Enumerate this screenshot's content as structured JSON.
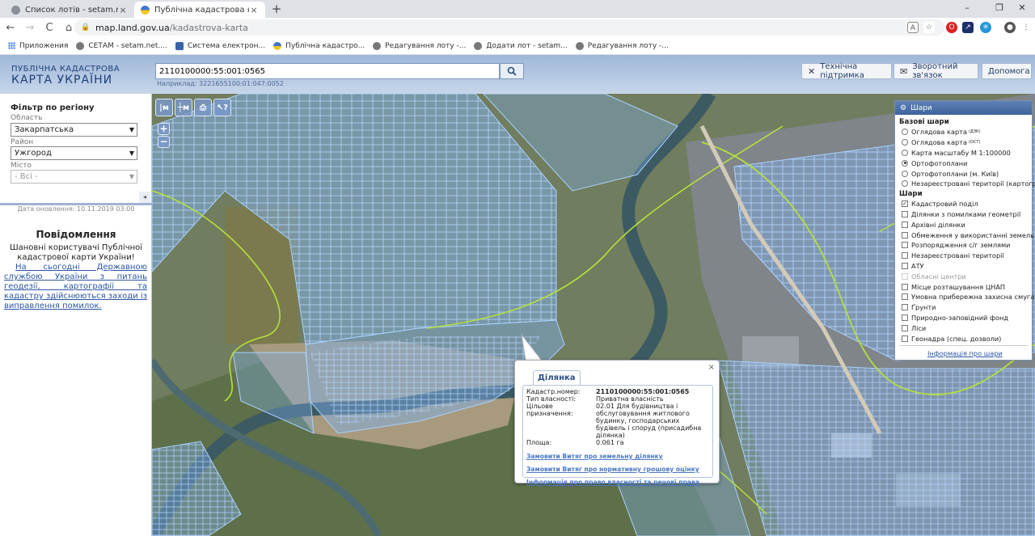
{
  "browser": {
    "tabs": [
      {
        "title": "Список лотів - setam.net.ua",
        "close": "×"
      },
      {
        "title": "Публічна кадастрова карта Укр",
        "close": "×"
      }
    ],
    "new_tab": "+",
    "window_controls": [
      "–",
      "❐",
      "✕"
    ],
    "nav": [
      "←",
      "→",
      "C",
      "⌂"
    ],
    "url_host": "map.land.gov.ua",
    "url_path": "/kadastrova-karta",
    "bookmarks": [
      "Приложения",
      "СЕТАМ - setam.net....",
      "Система електрон...",
      "Публічна кадастро...",
      "Редагування лоту -...",
      "Додати лот - setam...",
      "Редагування лоту -..."
    ]
  },
  "header": {
    "logo_line1": "ПУБЛІЧНА КАДАСТРОВА",
    "logo_line2": "КАРТА УКРАЇНИ",
    "search_value": "2110100000:55:001:0565",
    "search_hint": "Наприклад: 3221655100:01:047:0052",
    "buttons": {
      "support": "Технічна підтримка",
      "feedback": "Зворотний зв'язок",
      "help": "Допомога"
    }
  },
  "sidebar": {
    "filter_title": "Фільтр по регіону",
    "region_label": "Область",
    "region_value": "Закарпатська",
    "district_label": "Район",
    "district_value": "Ужгород",
    "city_label": "Місто",
    "city_value": "- Всі -",
    "collapse": "◂",
    "update_date": "Дата оновлення: 10.11.2019 03:00",
    "news_title": "Повідомлення",
    "greeting": "Шановні користувачі Публічної кадастрової карти України!",
    "notice_link": "На сьогодні Державною службою України з питань геодезії, картографії та кадастру здійснюються заходи із виправлення помилок."
  },
  "map_tools": [
    "|м",
    "┼м",
    "⎙",
    "↖?"
  ],
  "zoom": {
    "in": "+",
    "out": "−"
  },
  "layers": {
    "title": "Шари",
    "base_title": "Базові шари",
    "base": [
      {
        "label": "Оглядова карта",
        "sup": "(ДЗК)",
        "selected": false
      },
      {
        "label": "Оглядова карта",
        "sup": "(ОСТ)",
        "selected": false
      },
      {
        "label": "Карта масштабу М 1:100000",
        "sup": "",
        "selected": false
      },
      {
        "label": "Ортофотоплани",
        "sup": "",
        "selected": true
      },
      {
        "label": "Ортофотоплани (м. Київ)",
        "sup": "",
        "selected": false
      },
      {
        "label": "Незареєстровані території (картограма)",
        "sup": "",
        "selected": false
      }
    ],
    "overlay_title": "Шари",
    "overlays": [
      {
        "label": "Кадастровий поділ",
        "checked": true,
        "disabled": false
      },
      {
        "label": "Ділянки з помилками геометрії",
        "checked": false,
        "disabled": false
      },
      {
        "label": "Архівні ділянки",
        "checked": false,
        "disabled": false
      },
      {
        "label": "Обмеження у використанні земель",
        "checked": false,
        "disabled": false
      },
      {
        "label": "Розпорядження с/г землями",
        "checked": false,
        "disabled": false
      },
      {
        "label": "Незареєстровані території",
        "checked": false,
        "disabled": false
      },
      {
        "label": "АТУ",
        "checked": false,
        "disabled": false
      },
      {
        "label": "Обласні центри",
        "checked": false,
        "disabled": true
      },
      {
        "label": "Місце розташування ЦНАП",
        "checked": false,
        "disabled": false
      },
      {
        "label": "Умовна прибережна захисна смуга",
        "checked": false,
        "disabled": false
      },
      {
        "label": "Ґрунти",
        "checked": false,
        "disabled": false
      },
      {
        "label": "Природно-заповідний фонд",
        "checked": false,
        "disabled": false
      },
      {
        "label": "Ліси",
        "checked": false,
        "disabled": false
      },
      {
        "label": "Геонадра (спец. дозволи)",
        "checked": false,
        "disabled": false
      }
    ],
    "info_link": "Інформація про шари"
  },
  "popup": {
    "tab": "Ділянка",
    "close": "×",
    "fields": [
      {
        "key": "Кадастр.номер:",
        "value": "2110100000:55:001:0565",
        "bold": true
      },
      {
        "key": "Тип власності:",
        "value": "Приватна власність",
        "bold": false
      },
      {
        "key": "Цільове призначення:",
        "value": "02.01 Для будівництва і обслуговування житлового будинку, господарських будівель і споруд (присадибна ділянка)",
        "bold": false
      },
      {
        "key": "Площа:",
        "value": "0.061 га",
        "bold": false
      }
    ],
    "links": [
      "Замовити Витяг про земельну ділянку",
      "Замовити Витяг про нормативну грошову оцінку",
      "Інформація про право власності та речові права"
    ]
  },
  "colors": {
    "header_gradient_top": "#9eb7d8",
    "parcel_fill": "#7fb2f0",
    "parcel_stroke": "#a9d2ff",
    "boundary_line": "#b4e13a",
    "river": "#3c5a62",
    "layers_header": "#3e649e"
  }
}
